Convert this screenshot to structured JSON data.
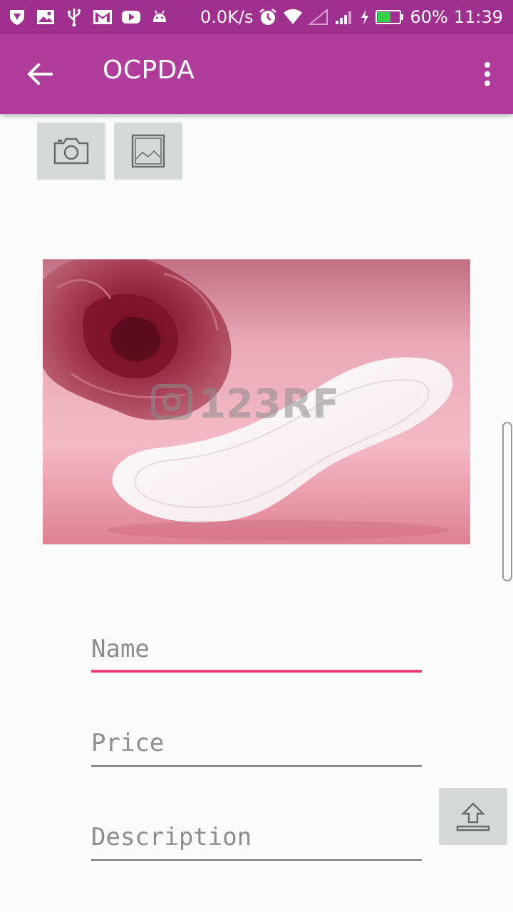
{
  "status_bar": {
    "network_speed": "0.0K/s",
    "battery_percent": "60%",
    "time": "11:39",
    "battery_level": 0.6,
    "left_icons": [
      "shield-app-icon",
      "image-notification-icon",
      "usb-icon",
      "gmail-icon",
      "youtube-icon",
      "android-icon"
    ],
    "right_icons": [
      "alarm-icon",
      "wifi-icon",
      "signal-empty-icon",
      "signal-icon",
      "charging-icon",
      "battery-icon"
    ]
  },
  "app_bar": {
    "title": "OCPDA",
    "back_icon": "arrow-left-icon",
    "menu_icon": "more-vertical-icon"
  },
  "image_pickers": {
    "camera_icon": "camera-icon",
    "gallery_icon": "image-icon"
  },
  "product_image": {
    "watermark": "123RF",
    "description_icon": "photo"
  },
  "form": {
    "name": {
      "placeholder": "Name",
      "value": ""
    },
    "price": {
      "placeholder": "Price",
      "value": ""
    },
    "description": {
      "placeholder": "Description",
      "value": ""
    }
  },
  "upload_button": {
    "icon": "upload-icon"
  },
  "colors": {
    "status_bar": "#a0308f",
    "app_bar": "#b03c9c",
    "accent": "#ec407a",
    "button_bg": "#d6d7d7",
    "background": "#fafafa"
  }
}
